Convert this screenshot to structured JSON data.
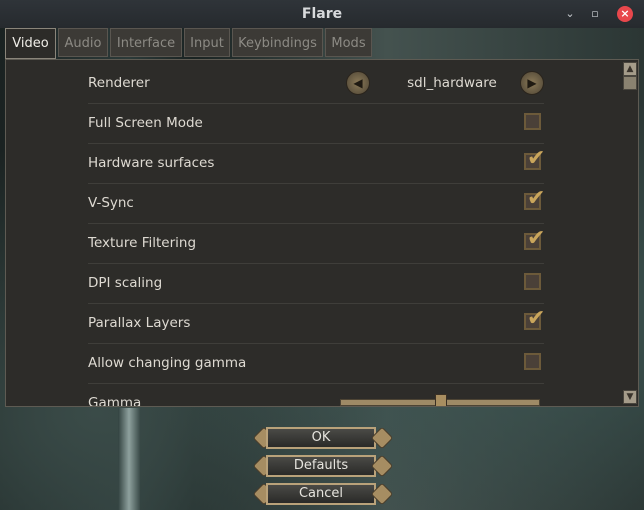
{
  "window": {
    "title": "Flare"
  },
  "tabs": [
    "Video",
    "Audio",
    "Interface",
    "Input",
    "Keybindings",
    "Mods"
  ],
  "settings": {
    "renderer": {
      "label": "Renderer",
      "value": "sdl_hardware"
    },
    "options": [
      {
        "label": "Full Screen Mode",
        "checked": false
      },
      {
        "label": "Hardware surfaces",
        "checked": true
      },
      {
        "label": "V-Sync",
        "checked": true
      },
      {
        "label": "Texture Filtering",
        "checked": true
      },
      {
        "label": "DPI scaling",
        "checked": false
      },
      {
        "label": "Parallax Layers",
        "checked": true
      },
      {
        "label": "Allow changing gamma",
        "checked": false
      }
    ],
    "gamma": {
      "label": "Gamma",
      "level": 0.5
    }
  },
  "buttons": {
    "ok": "OK",
    "defaults": "Defaults",
    "cancel": "Cancel"
  },
  "icons": {
    "check": "✔"
  }
}
